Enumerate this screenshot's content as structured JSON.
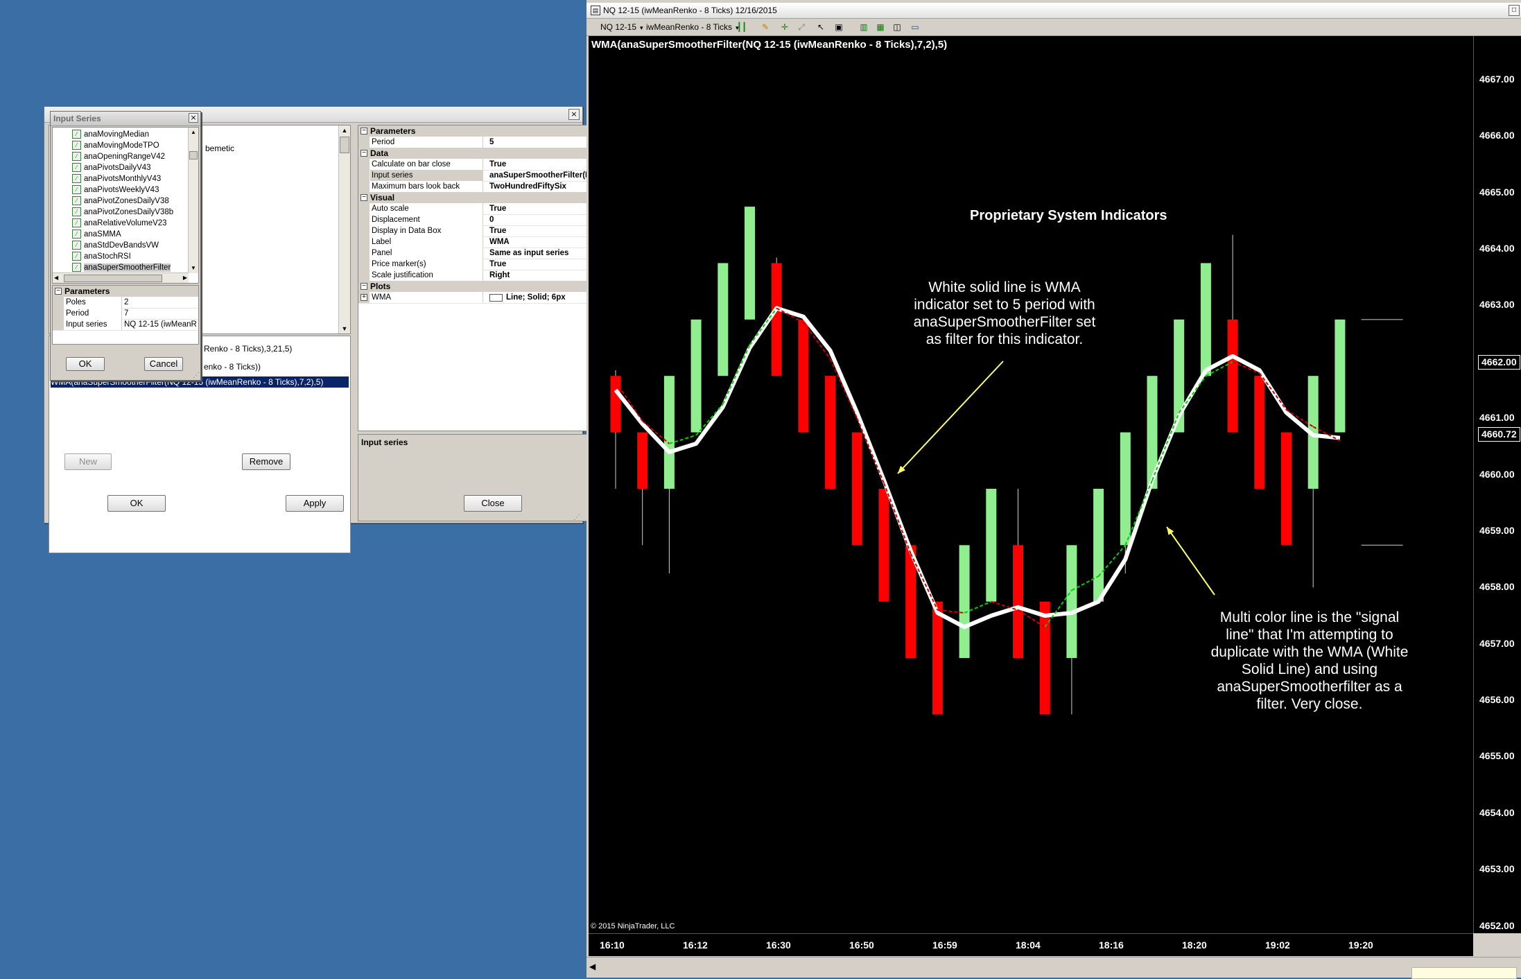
{
  "dialog": {
    "partial_texts": [
      "bemetic",
      "Renko - 8 Ticks),3,21,5)",
      "enko - 8 Ticks))"
    ],
    "selected_indicator": "WMA(anaSuperSmootherFilter(NQ 12-15 (iwMeanRenko - 8 Ticks),7,2),5)",
    "buttons": {
      "new": "New",
      "remove": "Remove",
      "ok": "OK",
      "apply": "Apply",
      "close": "Close"
    },
    "property_grid": {
      "parameters": {
        "title": "Parameters",
        "rows": [
          {
            "label": "Period",
            "value": "5"
          }
        ]
      },
      "data": {
        "title": "Data",
        "rows": [
          {
            "label": "Calculate on bar close",
            "value": "True"
          },
          {
            "label": "Input series",
            "value": "anaSuperSmootherFilter(NQ 12-15"
          },
          {
            "label": "Maximum bars look back",
            "value": "TwoHundredFiftySix"
          }
        ]
      },
      "visual": {
        "title": "Visual",
        "rows": [
          {
            "label": "Auto scale",
            "value": "True"
          },
          {
            "label": "Displacement",
            "value": "0"
          },
          {
            "label": "Display in Data Box",
            "value": "True"
          },
          {
            "label": "Label",
            "value": "WMA"
          },
          {
            "label": "Panel",
            "value": "Same as input series"
          },
          {
            "label": "Price marker(s)",
            "value": "True"
          },
          {
            "label": "Scale justification",
            "value": "Right"
          }
        ]
      },
      "plots": {
        "title": "Plots",
        "rows": [
          {
            "label": "WMA",
            "value": "Line; Solid; 6px"
          }
        ]
      }
    },
    "description_title": "Input series"
  },
  "input_series": {
    "title": "Input Series",
    "items": [
      "anaMovingMedian",
      "anaMovingModeTPO",
      "anaOpeningRangeV42",
      "anaPivotsDailyV43",
      "anaPivotsMonthlyV43",
      "anaPivotsWeeklyV43",
      "anaPivotZonesDailyV38",
      "anaPivotZonesDailyV38b",
      "anaRelativeVolumeV23",
      "anaSMMA",
      "anaStdDevBandsVW",
      "anaStochRSI",
      "anaSuperSmootherFilter"
    ],
    "selected": "anaSuperSmootherFilter",
    "parameters_title": "Parameters",
    "params": [
      {
        "label": "Poles",
        "value": "2"
      },
      {
        "label": "Period",
        "value": "7"
      },
      {
        "label": "Input series",
        "value": "NQ 12-15 (iwMeanRen"
      }
    ],
    "ok": "OK",
    "cancel": "Cancel"
  },
  "chart_window": {
    "title": "NQ 12-15 (iwMeanRenko - 8 Ticks)  12/16/2015",
    "toolbar": {
      "instrument": "NQ 12-15",
      "bar_type": "iwMeanRenko - 8 Ticks"
    },
    "indicator_label": "WMA(anaSuperSmootherFilter(NQ 12-15 (iwMeanRenko - 8 Ticks),7,2),5)",
    "copyright": "© 2015 NinjaTrader, LLC",
    "heading": "Proprietary System Indicators",
    "annotation_1": "White solid line is WMA\nindicator set to 5 period with\nanaSuperSmootherFilter set\nas filter for this indicator.",
    "annotation_2": "Multi color line is the \"signal\nline\" that I'm attempting to\nduplicate with the WMA (White\nSolid Line) and using\nanaSuperSmootherfilter as a\nfilter.  Very close.",
    "price_tags": [
      "4662.00",
      "4660.72"
    ],
    "colors": {
      "up": "#90ee90",
      "down": "#ff0000",
      "wma": "#ffffff",
      "signal_up": "#00d000",
      "signal_down": "#d00000",
      "arrow": "#ffff66"
    }
  },
  "chart_data": {
    "type": "candlestick",
    "y_ticks": [
      "4667.00",
      "4666.00",
      "4665.00",
      "4664.00",
      "4663.00",
      "4662.00",
      "4661.00",
      "4660.00",
      "4659.00",
      "4658.00",
      "4657.00",
      "4656.00",
      "4655.00",
      "4654.00",
      "4653.00",
      "4652.00"
    ],
    "ylim": [
      4651.6,
      4667.45
    ],
    "x_ticks": [
      "16:10",
      "16:12",
      "16:30",
      "16:50",
      "16:59",
      "18:04",
      "18:16",
      "18:20",
      "19:02",
      "19:20"
    ],
    "bars": [
      {
        "open": 4660.75,
        "close": 4661.75,
        "high": 4661.85,
        "low": 4659.75,
        "dir": "down"
      },
      {
        "open": 4659.75,
        "close": 4660.75,
        "high": 4660.75,
        "low": 4658.75,
        "dir": "down"
      },
      {
        "open": 4659.75,
        "close": 4661.75,
        "high": 4661.75,
        "low": 4658.25,
        "dir": "up"
      },
      {
        "open": 4660.75,
        "close": 4662.75,
        "high": 4662.75,
        "low": 4660.75,
        "dir": "up"
      },
      {
        "open": 4661.75,
        "close": 4663.75,
        "high": 4663.75,
        "low": 4661.75,
        "dir": "up"
      },
      {
        "open": 4662.75,
        "close": 4664.75,
        "high": 4664.75,
        "low": 4662.75,
        "dir": "up"
      },
      {
        "open": 4661.75,
        "close": 4663.75,
        "high": 4663.85,
        "low": 4661.75,
        "dir": "down"
      },
      {
        "open": 4660.75,
        "close": 4662.75,
        "high": 4662.75,
        "low": 4660.75,
        "dir": "down"
      },
      {
        "open": 4659.75,
        "close": 4661.75,
        "high": 4661.75,
        "low": 4659.75,
        "dir": "down"
      },
      {
        "open": 4658.75,
        "close": 4660.75,
        "high": 4660.75,
        "low": 4658.75,
        "dir": "down"
      },
      {
        "open": 4657.75,
        "close": 4659.75,
        "high": 4659.75,
        "low": 4657.75,
        "dir": "down"
      },
      {
        "open": 4656.75,
        "close": 4658.75,
        "high": 4658.75,
        "low": 4656.75,
        "dir": "down"
      },
      {
        "open": 4655.75,
        "close": 4657.75,
        "high": 4657.75,
        "low": 4655.75,
        "dir": "down"
      },
      {
        "open": 4656.75,
        "close": 4658.75,
        "high": 4658.75,
        "low": 4656.75,
        "dir": "up"
      },
      {
        "open": 4657.75,
        "close": 4659.75,
        "high": 4659.75,
        "low": 4657.75,
        "dir": "up"
      },
      {
        "open": 4656.75,
        "close": 4658.75,
        "high": 4659.75,
        "low": 4656.75,
        "dir": "down"
      },
      {
        "open": 4655.75,
        "close": 4657.75,
        "high": 4657.75,
        "low": 4655.75,
        "dir": "down"
      },
      {
        "open": 4656.75,
        "close": 4658.75,
        "high": 4658.75,
        "low": 4655.75,
        "dir": "up"
      },
      {
        "open": 4657.75,
        "close": 4659.75,
        "high": 4659.75,
        "low": 4657.75,
        "dir": "up"
      },
      {
        "open": 4658.75,
        "close": 4660.75,
        "high": 4660.75,
        "low": 4658.25,
        "dir": "up"
      },
      {
        "open": 4659.75,
        "close": 4661.75,
        "high": 4661.75,
        "low": 4659.75,
        "dir": "up"
      },
      {
        "open": 4660.75,
        "close": 4662.75,
        "high": 4662.75,
        "low": 4660.75,
        "dir": "up"
      },
      {
        "open": 4661.75,
        "close": 4663.75,
        "high": 4663.75,
        "low": 4661.75,
        "dir": "up"
      },
      {
        "open": 4660.75,
        "close": 4662.75,
        "high": 4664.25,
        "low": 4660.75,
        "dir": "down"
      },
      {
        "open": 4659.75,
        "close": 4661.75,
        "high": 4661.75,
        "low": 4659.75,
        "dir": "down"
      },
      {
        "open": 4658.75,
        "close": 4660.75,
        "high": 4660.75,
        "low": 4658.75,
        "dir": "down"
      },
      {
        "open": 4659.75,
        "close": 4661.75,
        "high": 4661.75,
        "low": 4658.0,
        "dir": "up"
      },
      {
        "open": 4660.75,
        "close": 4662.75,
        "high": 4662.75,
        "low": 4660.75,
        "dir": "up"
      }
    ],
    "ghost_bar": {
      "high": 4662.75,
      "low": 4658.75
    },
    "wma": [
      4661.5,
      4660.9,
      4660.4,
      4660.55,
      4661.2,
      4662.25,
      4662.95,
      4662.8,
      4662.2,
      4661.1,
      4659.9,
      4658.65,
      4657.55,
      4657.3,
      4657.5,
      4657.65,
      4657.5,
      4657.55,
      4657.75,
      4658.5,
      4659.9,
      4661.05,
      4661.85,
      4662.1,
      4661.85,
      4661.1,
      4660.7,
      4660.65
    ],
    "signal": [
      4661.65,
      4660.95,
      4660.55,
      4660.7,
      4661.25,
      4662.3,
      4662.95,
      4662.7,
      4662.05,
      4661.0,
      4659.85,
      4658.6,
      4657.6,
      4657.55,
      4657.75,
      4657.6,
      4657.3,
      4657.95,
      4658.2,
      4658.75,
      4659.9,
      4661.1,
      4661.75,
      4662.0,
      4661.8,
      4661.15,
      4660.85,
      4660.6
    ]
  }
}
